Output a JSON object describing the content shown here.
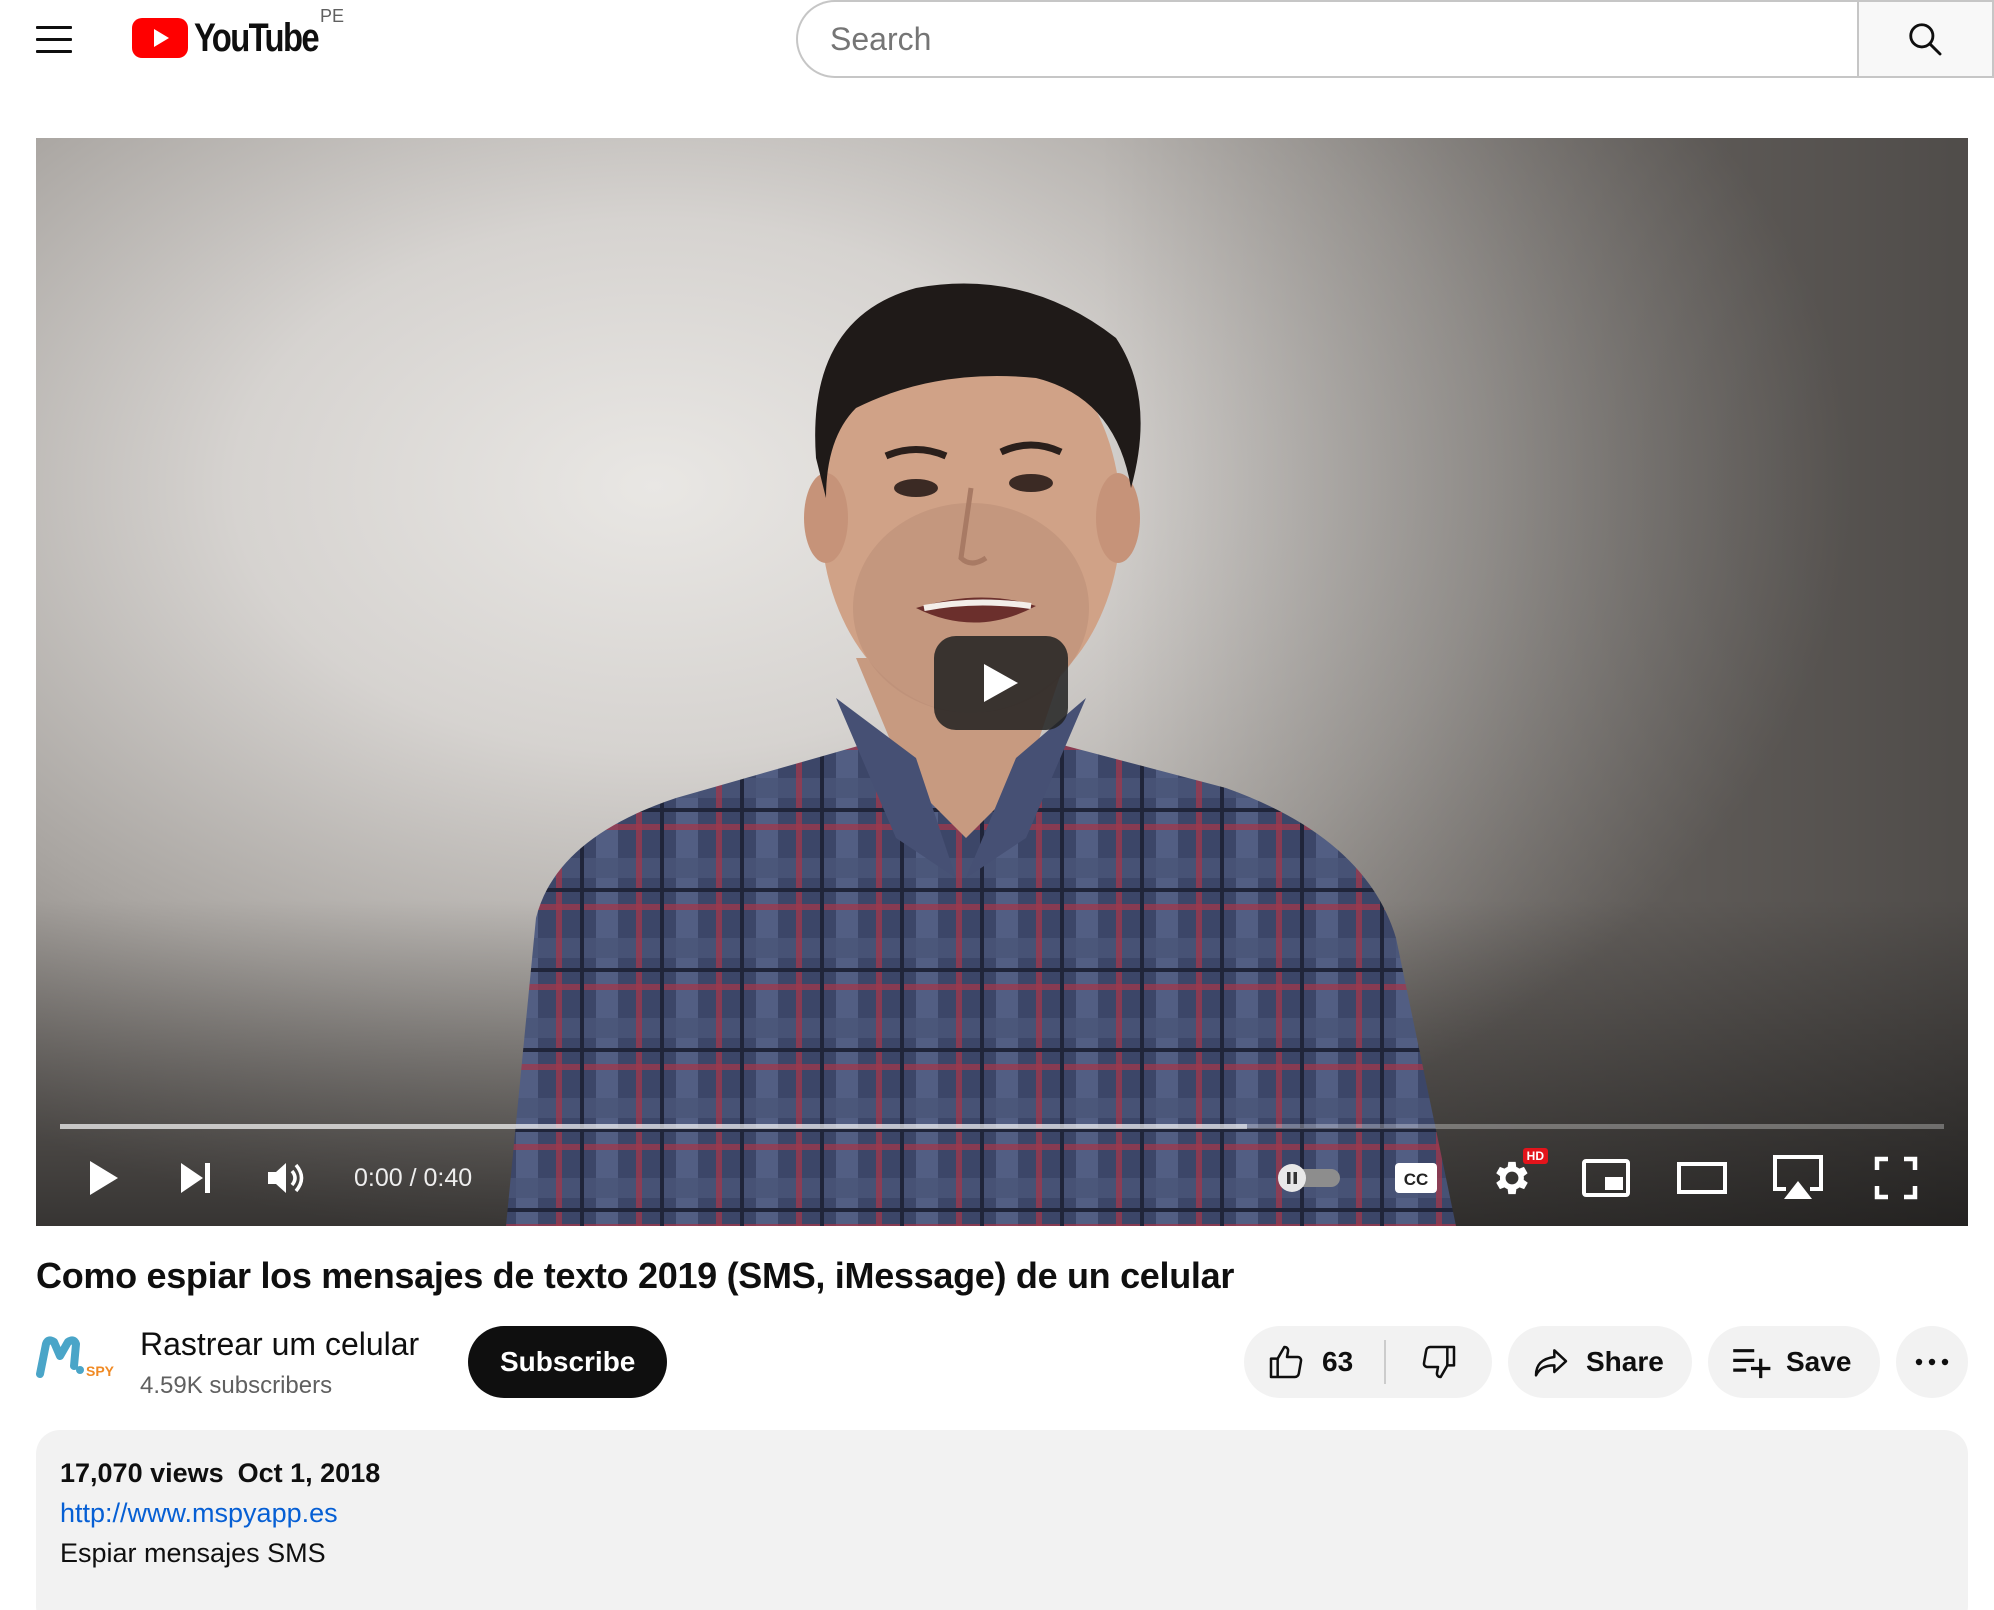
{
  "header": {
    "logo_text": "YouTube",
    "country_code": "PE",
    "search": {
      "placeholder": "Search",
      "value": ""
    }
  },
  "player": {
    "time_current": "0:00",
    "time_separator": "/",
    "time_duration": "0:40",
    "buffered_fraction": 0.63,
    "played_fraction": 0,
    "hd_badge": "HD",
    "cc_label": "CC",
    "autoplay_on": false
  },
  "video": {
    "title": "Como espiar los mensajes de texto 2019 (SMS, iMessage) de un celular",
    "channel": {
      "name": "Rastrear um celular",
      "subscribers": "4.59K subscribers",
      "avatar_text": "M. SPY"
    },
    "subscribe_label": "Subscribe",
    "actions": {
      "like_count": "63",
      "share_label": "Share",
      "save_label": "Save",
      "more_label": "..."
    }
  },
  "description": {
    "views": "17,070 views",
    "date": "Oct 1, 2018",
    "link": "http://www.mspyapp.es",
    "text": "Espiar mensajes SMS"
  },
  "colors": {
    "brand_red": "#ff0000",
    "link_blue": "#065fd4",
    "subscribe_bg": "#0f0f0f",
    "pill_bg": "#f2f2f2"
  }
}
